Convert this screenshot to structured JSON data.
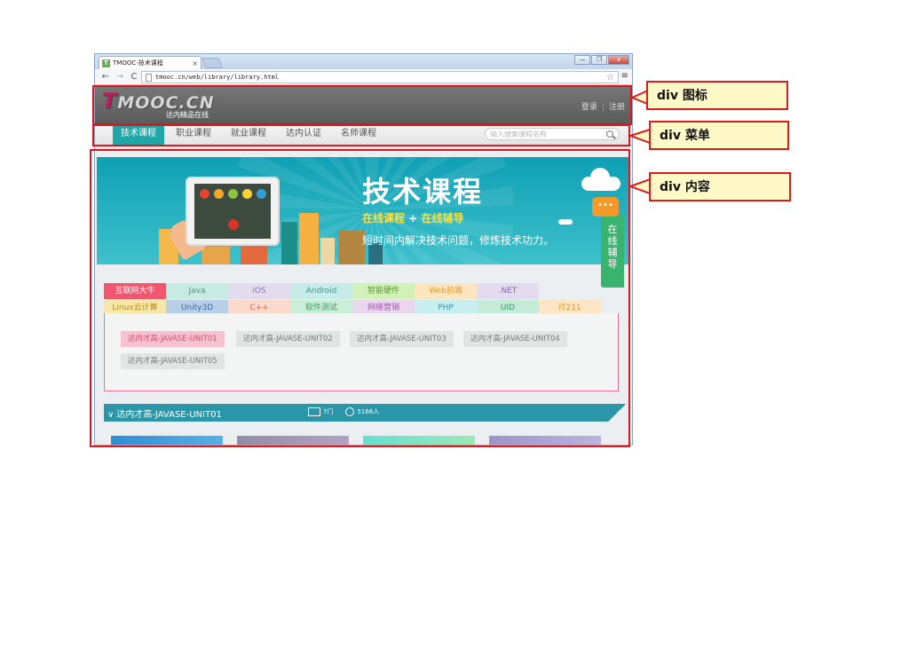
{
  "browser": {
    "tab_title": "TMOOC-技术课程",
    "tab_close": "×",
    "url": "tmooc.cn/web/library/library.html",
    "nav_back": "←",
    "nav_forward": "→",
    "nav_reload": "C",
    "star": "☆",
    "menu": "≡",
    "window_buttons": {
      "minimize": "—",
      "restore": "❐",
      "close": "x"
    }
  },
  "header": {
    "logo_text": "MOOC.CN",
    "logo_letter": "T",
    "logo_sub": "达内精品在线",
    "login": "登录",
    "separator": "|",
    "register": "注册"
  },
  "menu": {
    "items": [
      "技术课程",
      "职业课程",
      "就业课程",
      "达内认证",
      "名师课程"
    ],
    "search_placeholder": "输入搜索课程名称"
  },
  "banner": {
    "title": "技术课程",
    "sub_online_course": "在线课程",
    "sub_plus": " + ",
    "sub_online_tutor": "在线辅导",
    "desc": "短时间内解决技术问题，修炼技术功力。",
    "chat_bubble": "•••",
    "side_service": [
      "在",
      "线",
      "辅",
      "导"
    ]
  },
  "categories": {
    "row1": [
      {
        "label": "互联网大牛",
        "bg": "#f1566e",
        "fg": "#ffffff"
      },
      {
        "label": "Java",
        "bg": "#c7ebe0",
        "fg": "#3f9c7c"
      },
      {
        "label": "iOS",
        "bg": "#e3dcee",
        "fg": "#8a6cb5"
      },
      {
        "label": "Android",
        "bg": "#c6ebe8",
        "fg": "#2b9a92"
      },
      {
        "label": "智能硬件",
        "bg": "#d1f1b9",
        "fg": "#5e9a2f"
      },
      {
        "label": "Web前端",
        "bg": "#fde5c0",
        "fg": "#e59a2b"
      },
      {
        "label": ".NET",
        "bg": "#e4dbf0",
        "fg": "#8162ad"
      }
    ],
    "row2": [
      {
        "label": "Linux云计算",
        "bg": "#f7e7a9",
        "fg": "#b38e1f"
      },
      {
        "label": "Unity3D",
        "bg": "#b9cfe8",
        "fg": "#3868a2"
      },
      {
        "label": "C++",
        "bg": "#fbd9cc",
        "fg": "#e2613c"
      },
      {
        "label": "软件测试",
        "bg": "#cbeed8",
        "fg": "#3f9b63"
      },
      {
        "label": "网络营销",
        "bg": "#ead6ee",
        "fg": "#a055ae"
      },
      {
        "label": "PHP",
        "bg": "#c9eef0",
        "fg": "#2b9aa7"
      },
      {
        "label": "UID",
        "bg": "#c5ecd9",
        "fg": "#2f9868"
      },
      {
        "label": "IT211",
        "bg": "#fde5c6",
        "fg": "#e5962f"
      }
    ]
  },
  "units": [
    "达内才高-JAVASE-UNIT01",
    "达内才高-JAVASE-UNIT02",
    "达内才高-JAVASE-UNIT03",
    "达内才高-JAVASE-UNIT04",
    "达内才高-JAVASE-UNIT05"
  ],
  "course_bar": {
    "chevron": "∨",
    "title": "达内才高-JAVASE-UNIT01",
    "lessons": "7门",
    "students": "5166人"
  },
  "callouts": {
    "logo": "div 图标",
    "menu": "div 菜单",
    "content": "div 内容"
  },
  "colors": {
    "outline": "#e0141c",
    "callout_bg": "#fff9c8",
    "teal": "#1fa7a8"
  }
}
